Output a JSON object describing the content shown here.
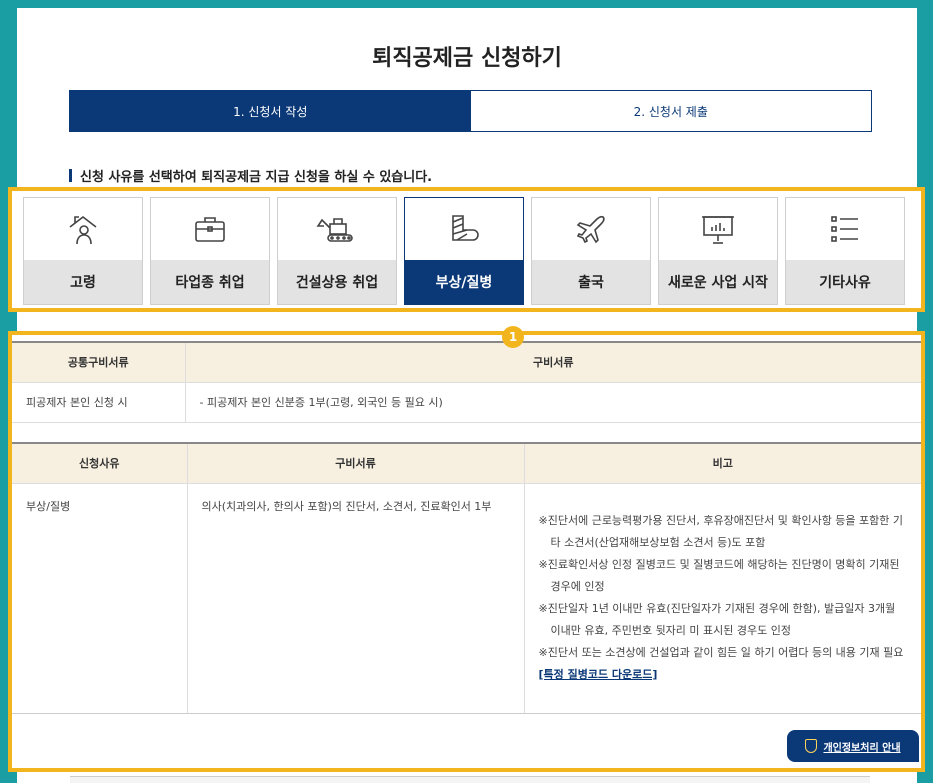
{
  "page": {
    "title": "퇴직공제금 신청하기"
  },
  "steps": [
    {
      "label": "1. 신청서 작성",
      "active": true
    },
    {
      "label": "2. 신청서 제출",
      "active": false
    }
  ],
  "guide_text": "신청 사유를 선택하여 퇴직공제금 지급 신청을 하실 수 있습니다.",
  "reasons": [
    {
      "label": "고령",
      "icon": "elderly-person-icon"
    },
    {
      "label": "타업종 취업",
      "icon": "briefcase-icon"
    },
    {
      "label": "건설상용 취업",
      "icon": "excavator-icon"
    },
    {
      "label": "부상/질병",
      "icon": "cast-bandage-icon",
      "selected": true
    },
    {
      "label": "출국",
      "icon": "airplane-icon"
    },
    {
      "label": "새로운 사업 시작",
      "icon": "presentation-board-icon"
    },
    {
      "label": "기타사유",
      "icon": "list-icon"
    }
  ],
  "badge": "1",
  "common_docs": {
    "headers": [
      "공통구비서류",
      "구비서류"
    ],
    "rows": [
      [
        "피공제자 본인 신청 시",
        "- 피공제자 본인 신분증 1부(고령, 외국인 등 필요 시)"
      ]
    ]
  },
  "reason_docs": {
    "headers": [
      "신청사유",
      "구비서류",
      "비고"
    ],
    "reason": "부상/질병",
    "documents": "의사(치과의사, 한의사 포함)의 진단서, 소견서, 진료확인서 1부",
    "notes": [
      "※진단서에 근로능력평가용 진단서, 후유장애진단서 및 확인사항 등을 포함한 기타 소견서(산업재해보상보험 소견서 등)도 포함",
      "※진료확인서상 인정 질병코드 및 질병코드에 해당하는 진단명이 명확히 기재된 경우에 인정",
      "※진단일자 1년 이내만 유효(진단일자가 기재된 경우에 한함), 발급일자 3개월 이내만 유효, 주민번호 뒷자리 미 표시된 경우도 인정",
      "※진단서 또는 소견상에 건설업과 같이 힘든 일 하기 어렵다 등의 내용 기재 필요"
    ],
    "download_link": "[특정 질병코드 다운로드]"
  },
  "privacy_button": "개인정보처리 안내",
  "colors": {
    "primary": "#0b3978",
    "highlight": "#f2b51d",
    "background": "#1a9ea3"
  }
}
